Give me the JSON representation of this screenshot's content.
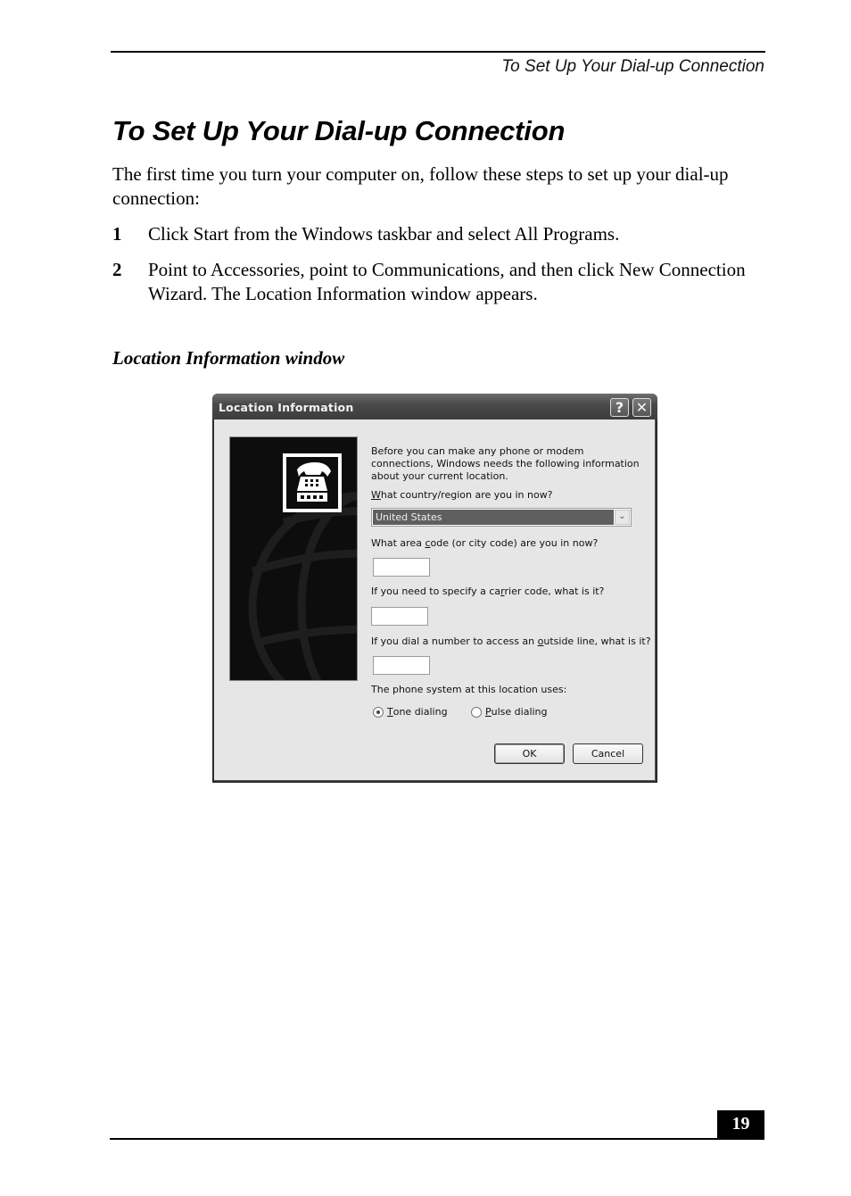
{
  "running_header": "To Set Up Your Dial-up Connection",
  "page_title": "To Set Up Your Dial-up Connection",
  "intro": "The first time you turn your computer on, follow these steps to set up your dial-up connection:",
  "steps": [
    {
      "number": "1",
      "text": "Click Start from the Windows taskbar and select All Programs."
    },
    {
      "number": "2",
      "text": "Point to Accessories, point to Communications, and then click New Connection Wizard. The Location Information window appears."
    }
  ],
  "figure_caption": "Location Information window",
  "dialog": {
    "title": "Location Information",
    "help_icon": "?",
    "close_icon": "✕",
    "side_icon": "telephone-icon",
    "intro_text": "Before you can make any phone or modem connections, Windows needs the following information about your current location.",
    "country_label": {
      "accel": "W",
      "rest": "hat country/region are you in now?"
    },
    "country_value": "United States",
    "dropdown_icon": "⌄",
    "area_code_label": {
      "pre": "What area ",
      "accel": "c",
      "rest": "ode (or city code) are you in now?"
    },
    "area_code_value": "",
    "carrier_label": {
      "pre": "If you need to specify a ca",
      "accel": "r",
      "rest": "rier code, what is it?"
    },
    "carrier_value": "",
    "outside_line_label": {
      "pre": "If you dial a number to access an ",
      "accel": "o",
      "rest": "utside line, what is it?"
    },
    "outside_line_value": "",
    "phone_system_label": "The phone system at this location uses:",
    "tone": {
      "accel": "T",
      "rest": "one dialing",
      "checked": true
    },
    "pulse": {
      "accel": "P",
      "rest": "ulse dialing",
      "checked": false
    },
    "ok_label": "OK",
    "cancel_label": "Cancel"
  },
  "page_number": "19"
}
